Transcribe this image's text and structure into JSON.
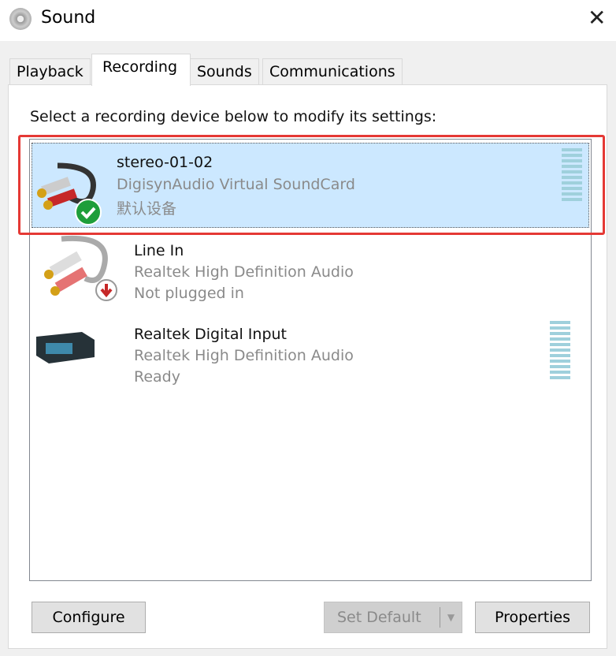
{
  "window": {
    "title": "Sound",
    "close": "✕"
  },
  "tabs": [
    {
      "label": "Playback"
    },
    {
      "label": "Recording",
      "active": true
    },
    {
      "label": "Sounds"
    },
    {
      "label": "Communications"
    }
  ],
  "instruction": "Select a recording device below to modify its settings:",
  "devices": [
    {
      "name": "stereo-01-02",
      "driver": "DigisynAudio Virtual SoundCard",
      "status": "默认设备",
      "icon": "rca-cable-icon",
      "badge": "default-check-icon",
      "selected": true,
      "highlighted": true
    },
    {
      "name": "Line In",
      "driver": "Realtek High Definition Audio",
      "status": "Not plugged in",
      "icon": "rca-cable-icon",
      "badge": "unplugged-icon"
    },
    {
      "name": "Realtek Digital Input",
      "driver": "Realtek High Definition Audio",
      "status": "Ready",
      "icon": "digital-receiver-icon"
    }
  ],
  "buttons": {
    "configure": "Configure",
    "set_default": "Set Default",
    "properties": "Properties"
  },
  "colors": {
    "selection": "#cce8ff",
    "highlight": "#e53935",
    "meter": "#9fd0dc"
  }
}
